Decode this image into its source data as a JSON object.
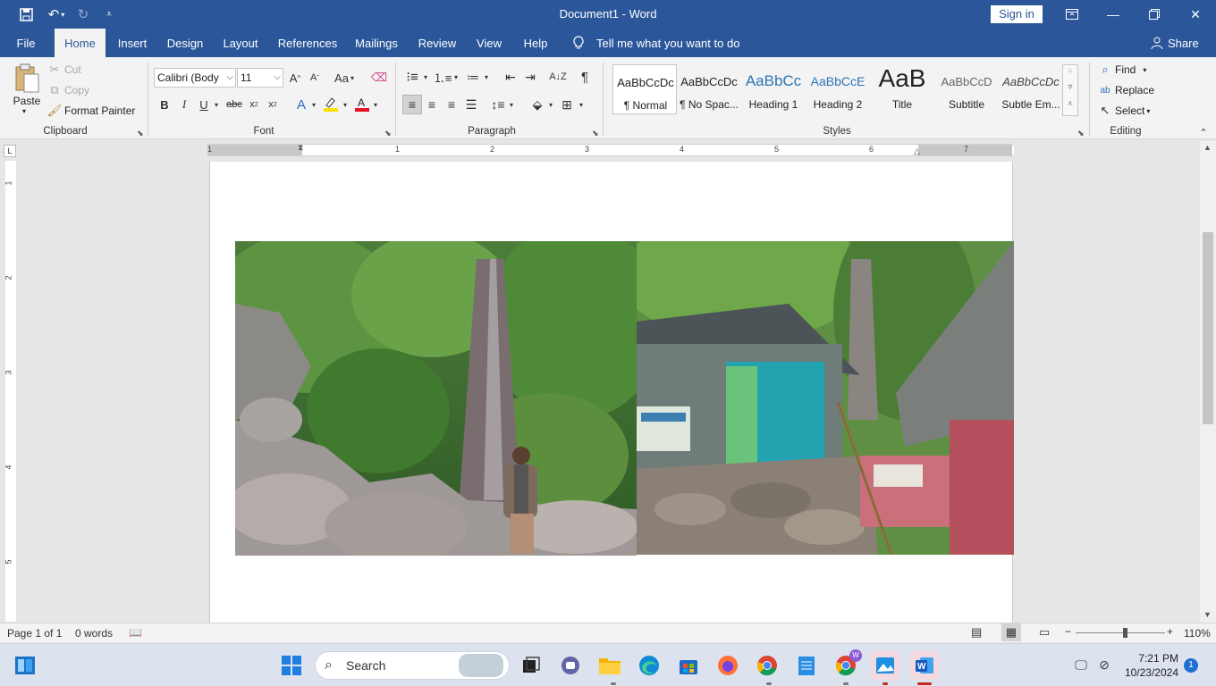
{
  "window": {
    "document_title": "Document1 - Word",
    "signin_label": "Sign in"
  },
  "tabs": [
    {
      "label": "File"
    },
    {
      "label": "Home"
    },
    {
      "label": "Insert"
    },
    {
      "label": "Design"
    },
    {
      "label": "Layout"
    },
    {
      "label": "References"
    },
    {
      "label": "Mailings"
    },
    {
      "label": "Review"
    },
    {
      "label": "View"
    },
    {
      "label": "Help"
    }
  ],
  "tellme": "Tell me what you want to do",
  "share": "Share",
  "clipboard": {
    "paste": "Paste",
    "cut": "Cut",
    "copy": "Copy",
    "format_painter": "Format Painter",
    "label": "Clipboard"
  },
  "font": {
    "family": "Calibri (Body",
    "size": "11",
    "change_case": "Aa",
    "label": "Font"
  },
  "paragraph": {
    "label": "Paragraph"
  },
  "styles": {
    "label": "Styles",
    "items": [
      {
        "preview": "AaBbCcDc",
        "name": "¶ Normal"
      },
      {
        "preview": "AaBbCcDc",
        "name": "¶ No Spac..."
      },
      {
        "preview": "AaBbCc",
        "name": "Heading 1"
      },
      {
        "preview": "AaBbCcE",
        "name": "Heading 2"
      },
      {
        "preview": "AaB",
        "name": "Title"
      },
      {
        "preview": "AaBbCcD",
        "name": "Subtitle"
      },
      {
        "preview": "AaBbCcDc",
        "name": "Subtle Em..."
      }
    ]
  },
  "editing": {
    "find": "Find",
    "replace": "Replace",
    "select": "Select",
    "label": "Editing"
  },
  "ruler": {
    "h_numbers": [
      "1",
      "1",
      "2",
      "3",
      "4",
      "5",
      "6",
      "7"
    ],
    "v_numbers": [
      "1",
      "2",
      "3",
      "4",
      "5"
    ]
  },
  "status": {
    "page": "Page 1 of 1",
    "words": "0 words",
    "zoom": "110%",
    "zoom_level": 0.55
  },
  "taskbar": {
    "search": "Search",
    "time": "7:21 PM",
    "date": "10/23/2024",
    "notification_count": "1",
    "chrome_badge": "W"
  },
  "colors": {
    "brand": "#2b579a",
    "ribbon": "#f3f3f3",
    "font_color_bar": "#e81123",
    "highlight_bar": "#ffe000"
  }
}
